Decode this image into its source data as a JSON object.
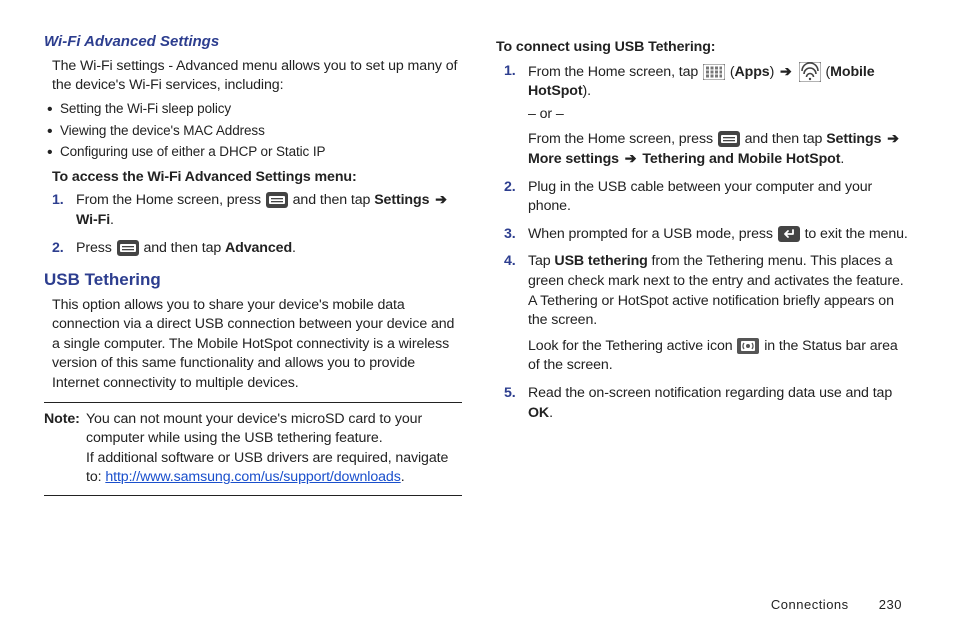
{
  "left": {
    "h_wifi": "Wi-Fi Advanced Settings",
    "wifi_intro": "The Wi-Fi settings - Advanced menu allows you to set up many of the device's Wi-Fi services, including:",
    "bullets": [
      "Setting the Wi-Fi sleep policy",
      "Viewing the device's MAC Address",
      "Configuring use of either a DHCP or Static IP"
    ],
    "access_heading": "To access the Wi-Fi Advanced Settings menu:",
    "step1_a": "From the Home screen, press ",
    "step1_b": " and then tap ",
    "step1_c_settings": "Settings",
    "step1_c_wifi": "Wi-Fi",
    "step2_a": "Press ",
    "step2_b": " and then tap ",
    "step2_c": "Advanced",
    "h_usb": "USB Tethering",
    "usb_intro": "This option allows you to share your device's mobile data connection via a direct USB connection between your device and a single computer. The Mobile HotSpot connectivity is a wireless version of this same functionality and allows you to provide Internet connectivity to multiple devices.",
    "note_label": "Note:",
    "note_l1": "You can not mount your device's microSD card to your computer while using the USB tethering feature.",
    "note_l2a": "If additional software or USB drivers are required, navigate to: ",
    "note_link": "http://www.samsung.com/us/support/downloads",
    "note_period": "."
  },
  "right": {
    "connect_heading": "To connect using USB Tethering:",
    "s1_a": "From the Home screen, tap ",
    "s1_apps": "Apps",
    "s1_hotspot": "Mobile HotSpot",
    "or": "– or –",
    "s1_b_a": "From the Home screen, press ",
    "s1_b_b": " and then tap ",
    "s1_b_settings": "Settings",
    "s1_b_more": "More settings",
    "s1_b_tether": "Tethering and Mobile HotSpot",
    "s2": "Plug in the USB cable between your computer and your phone.",
    "s3_a": "When prompted for a USB mode, press ",
    "s3_b": " to exit the menu.",
    "s4_a": "Tap ",
    "s4_b": "USB tethering",
    "s4_c": " from the Tethering menu. This places a green check mark next to the entry and activates the feature. A Tethering or HotSpot active notification briefly appears on the screen.",
    "s4_d": "Look for the Tethering active icon ",
    "s4_e": " in the Status bar area of the screen.",
    "s5_a": "Read the on-screen notification regarding data use and tap ",
    "s5_b": "OK",
    "s5_c": "."
  },
  "footer": {
    "section": "Connections",
    "page": "230"
  },
  "glyphs": {
    "arrow": "➔"
  }
}
